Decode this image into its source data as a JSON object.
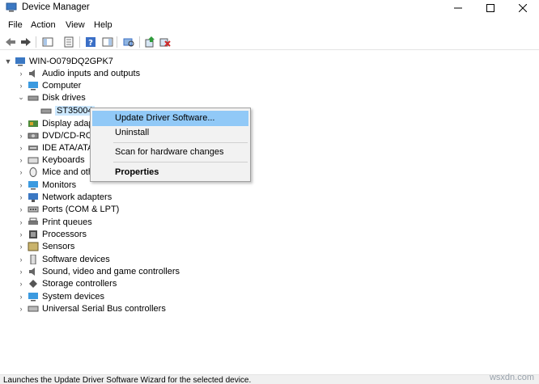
{
  "window": {
    "title": "Device Manager"
  },
  "menu": [
    "File",
    "Action",
    "View",
    "Help"
  ],
  "tree": {
    "root": "WIN-O079DQ2GPK7",
    "disk_drives": "Disk drives",
    "disk_device": "ST35004",
    "categories": [
      "Audio inputs and outputs",
      "Computer",
      "Display adap",
      "DVD/CD-RO",
      "IDE ATA/ATA",
      "Keyboards",
      "Mice and oth",
      "Monitors",
      "Network adapters",
      "Ports (COM & LPT)",
      "Print queues",
      "Processors",
      "Sensors",
      "Software devices",
      "Sound, video and game controllers",
      "Storage controllers",
      "System devices",
      "Universal Serial Bus controllers"
    ]
  },
  "context_menu": {
    "update": "Update Driver Software...",
    "uninstall": "Uninstall",
    "scan": "Scan for hardware changes",
    "properties": "Properties"
  },
  "status": "Launches the Update Driver Software Wizard for the selected device.",
  "watermark": "wsxdn.com"
}
